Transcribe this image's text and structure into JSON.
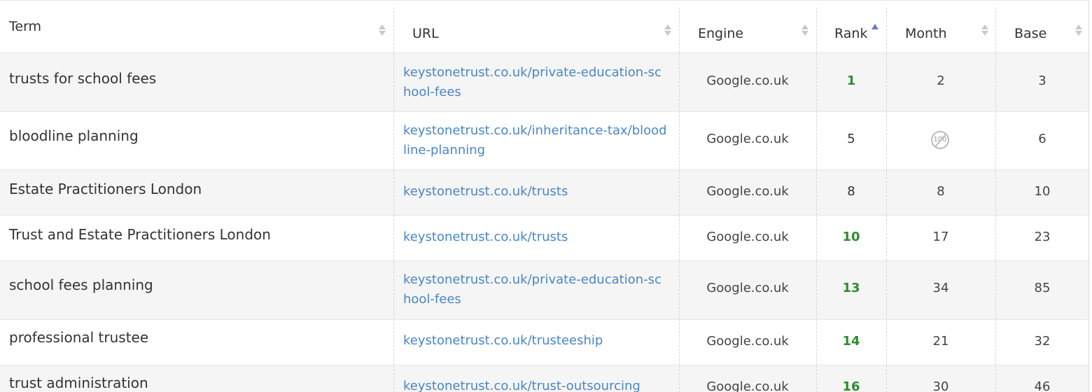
{
  "columns": {
    "term": "Term",
    "url": "URL",
    "engine": "Engine",
    "rank": "Rank",
    "month": "Month",
    "base": "Base"
  },
  "sort": {
    "column": "rank",
    "direction": "ascending"
  },
  "rows": [
    {
      "term": "trusts for school fees",
      "url": "keystonetrust.co.uk/private-education-school-fees",
      "engine": "Google.co.uk",
      "rank": "1",
      "rank_improved": true,
      "month": "2",
      "month_icon": "",
      "base": "3"
    },
    {
      "term": "bloodline planning",
      "url": "keystonetrust.co.uk/inheritance-tax/bloodline-planning",
      "engine": "Google.co.uk",
      "rank": "5",
      "rank_improved": false,
      "month": "",
      "month_icon": "not-in-top-100-icon",
      "month_icon_text": "100",
      "base": "6"
    },
    {
      "term": "Estate Practitioners London",
      "url": "keystonetrust.co.uk/trusts",
      "engine": "Google.co.uk",
      "rank": "8",
      "rank_improved": false,
      "month": "8",
      "month_icon": "",
      "base": "10"
    },
    {
      "term": "Trust and Estate Practitioners London",
      "url": "keystonetrust.co.uk/trusts",
      "engine": "Google.co.uk",
      "rank": "10",
      "rank_improved": true,
      "month": "17",
      "month_icon": "",
      "base": "23"
    },
    {
      "term": "school fees planning",
      "url": "keystonetrust.co.uk/private-education-school-fees",
      "engine": "Google.co.uk",
      "rank": "13",
      "rank_improved": true,
      "month": "34",
      "month_icon": "",
      "base": "85"
    },
    {
      "term": "professional trustee",
      "url": "keystonetrust.co.uk/trusteeship",
      "engine": "Google.co.uk",
      "rank": "14",
      "rank_improved": true,
      "month": "21",
      "month_icon": "",
      "base": "32"
    },
    {
      "term": "trust administration",
      "url": "keystonetrust.co.uk/trust-outsourcing",
      "engine": "Google.co.uk",
      "rank": "16",
      "rank_improved": true,
      "month": "30",
      "month_icon": "",
      "base": "46"
    }
  ],
  "colors": {
    "link": "#4a86c5",
    "rank_improved": "#2e8b2e",
    "sort_active": "#6b76c9",
    "row_alt": "#f5f5f5"
  }
}
